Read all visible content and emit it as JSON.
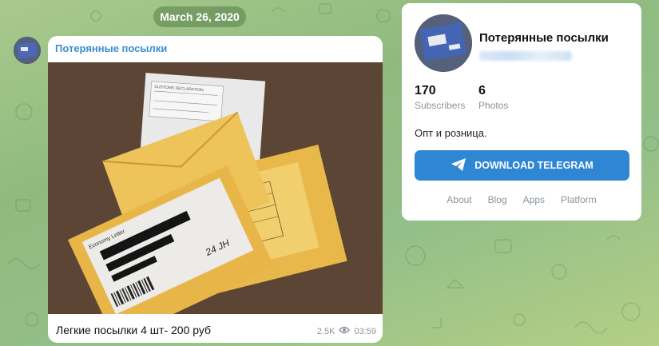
{
  "date_pill": "March 26, 2020",
  "post": {
    "channel_name": "Потерянные посылки",
    "caption": "Легкие посылки 4 шт- 200 руб",
    "views": "2.5K",
    "time": "03:59",
    "photo_labels": {
      "customs": "CUSTOMS DECLARATION",
      "economy": "Economy Letter",
      "handwriting": "24 JH"
    }
  },
  "card": {
    "title": "Потерянные посылки",
    "subscribers_count": "170",
    "subscribers_label": "Subscribers",
    "photos_count": "6",
    "photos_label": "Photos",
    "description": "Опт и розница.",
    "download_button": "DOWNLOAD TELEGRAM",
    "links": [
      "About",
      "Blog",
      "Apps",
      "Platform"
    ]
  },
  "icons": {
    "views": "eye-icon",
    "download": "telegram-plane-icon"
  },
  "colors": {
    "accent": "#2f86d3",
    "channel_name": "#3a8fd0",
    "muted": "#8a949c"
  }
}
